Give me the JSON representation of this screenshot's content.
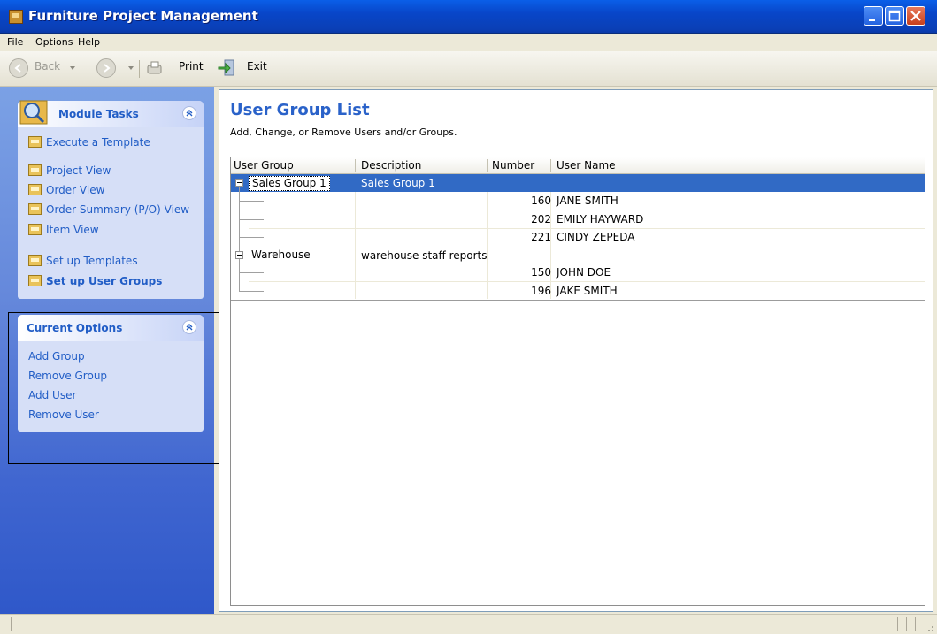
{
  "window": {
    "title": "Furniture Project Management"
  },
  "menu": {
    "file": "File",
    "options": "Options",
    "help": "Help"
  },
  "toolbar": {
    "back": "Back",
    "print": "Print",
    "exit": "Exit"
  },
  "module_tasks": {
    "title": "Module Tasks",
    "items": [
      {
        "label": "Execute a Template"
      },
      {
        "label": "Project View"
      },
      {
        "label": "Order View"
      },
      {
        "label": "Order Summary (P/O) View"
      },
      {
        "label": "Item View"
      },
      {
        "label": "Set up Templates"
      },
      {
        "label": "Set up User Groups"
      }
    ]
  },
  "current_options": {
    "title": "Current Options",
    "items": [
      {
        "label": "Add Group"
      },
      {
        "label": "Remove Group"
      },
      {
        "label": "Add User"
      },
      {
        "label": "Remove User"
      }
    ]
  },
  "main": {
    "title": "User Group List",
    "subtitle": "Add, Change, or Remove Users and/or Groups.",
    "columns": [
      "User Group",
      "Description",
      "Number",
      "User Name"
    ],
    "groups": [
      {
        "name": "Sales Group 1",
        "description": "Sales Group 1",
        "users": [
          {
            "number": "160",
            "name": "JANE SMITH"
          },
          {
            "number": "202",
            "name": "EMILY HAYWARD"
          },
          {
            "number": "221",
            "name": "CINDY ZEPEDA"
          }
        ]
      },
      {
        "name": "Warehouse",
        "description": "warehouse staff reports",
        "users": [
          {
            "number": "150",
            "name": "JOHN DOE"
          },
          {
            "number": "196",
            "name": "JAKE SMITH"
          }
        ]
      }
    ]
  },
  "colors": {
    "accent": "#2A62C9",
    "selection": "#316AC5",
    "link": "#215DC6"
  },
  "icons": {
    "app": "furniture-app-icon",
    "task": "task-folder-icon",
    "module": "magnifier-folder-icon"
  }
}
